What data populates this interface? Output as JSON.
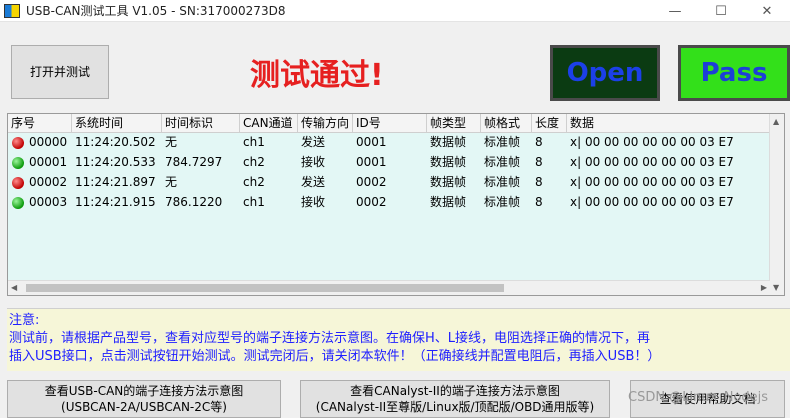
{
  "window": {
    "title": "USB-CAN测试工具 V1.05 - SN:317000273D8",
    "minimize": "—",
    "maximize": "☐",
    "close": "✕"
  },
  "controls": {
    "open_test_button": "打开并测试",
    "status_text": "测试通过!",
    "open_lamp": "Open",
    "pass_lamp": "Pass"
  },
  "colors": {
    "status_red": "#e62020",
    "open_lamp_bg": "#0b3b12",
    "open_lamp_text": "#1c40e8",
    "pass_lamp_bg": "#33e01a",
    "pass_lamp_text": "#1d3fd8",
    "notes_text": "#2020ff"
  },
  "table": {
    "columns": [
      "序号",
      "系统时间",
      "时间标识",
      "CAN通道",
      "传输方向",
      "ID号",
      "帧类型",
      "帧格式",
      "长度",
      "数据"
    ],
    "rows": [
      {
        "status": "red",
        "cells": [
          "00000",
          "11:24:20.502",
          "无",
          "ch1",
          "发送",
          "0001",
          "数据帧",
          "标准帧",
          "8",
          "x| 00 00 00 00 00 00 03 E7"
        ]
      },
      {
        "status": "green",
        "cells": [
          "00001",
          "11:24:20.533",
          "784.7297",
          "ch2",
          "接收",
          "0001",
          "数据帧",
          "标准帧",
          "8",
          "x| 00 00 00 00 00 00 03 E7"
        ]
      },
      {
        "status": "red",
        "cells": [
          "00002",
          "11:24:21.897",
          "无",
          "ch2",
          "发送",
          "0002",
          "数据帧",
          "标准帧",
          "8",
          "x| 00 00 00 00 00 00 03 E7"
        ]
      },
      {
        "status": "green",
        "cells": [
          "00003",
          "11:24:21.915",
          "786.1220",
          "ch1",
          "接收",
          "0002",
          "数据帧",
          "标准帧",
          "8",
          "x| 00 00 00 00 00 00 03 E7"
        ]
      }
    ]
  },
  "notes": {
    "heading": "注意:",
    "line1": "测试前，请根据产品型号，查看对应型号的端子连接方法示意图。在确保H、L接线，电阻选择正确的情况下，再",
    "line2": "插入USB接口，点击测试按钮开始测试。测试完闭后，请关闭本软件！（正确接线并配置电阻后，再插入USB！）"
  },
  "bottom_buttons": {
    "usbcan_line1": "查看USB-CAN的端子连接方法示意图",
    "usbcan_line2": "(USBCAN-2A/USBCAN-2C等)",
    "canalyst_line1": "查看CANalyst-II的端子连接方法示意图",
    "canalyst_line2": "(CANalyst-II至尊版/Linux版/顶配版/OBD通用版等)",
    "help_doc": "查看使用帮助文档"
  },
  "watermark": "CSDN @Linux_Nodejs"
}
